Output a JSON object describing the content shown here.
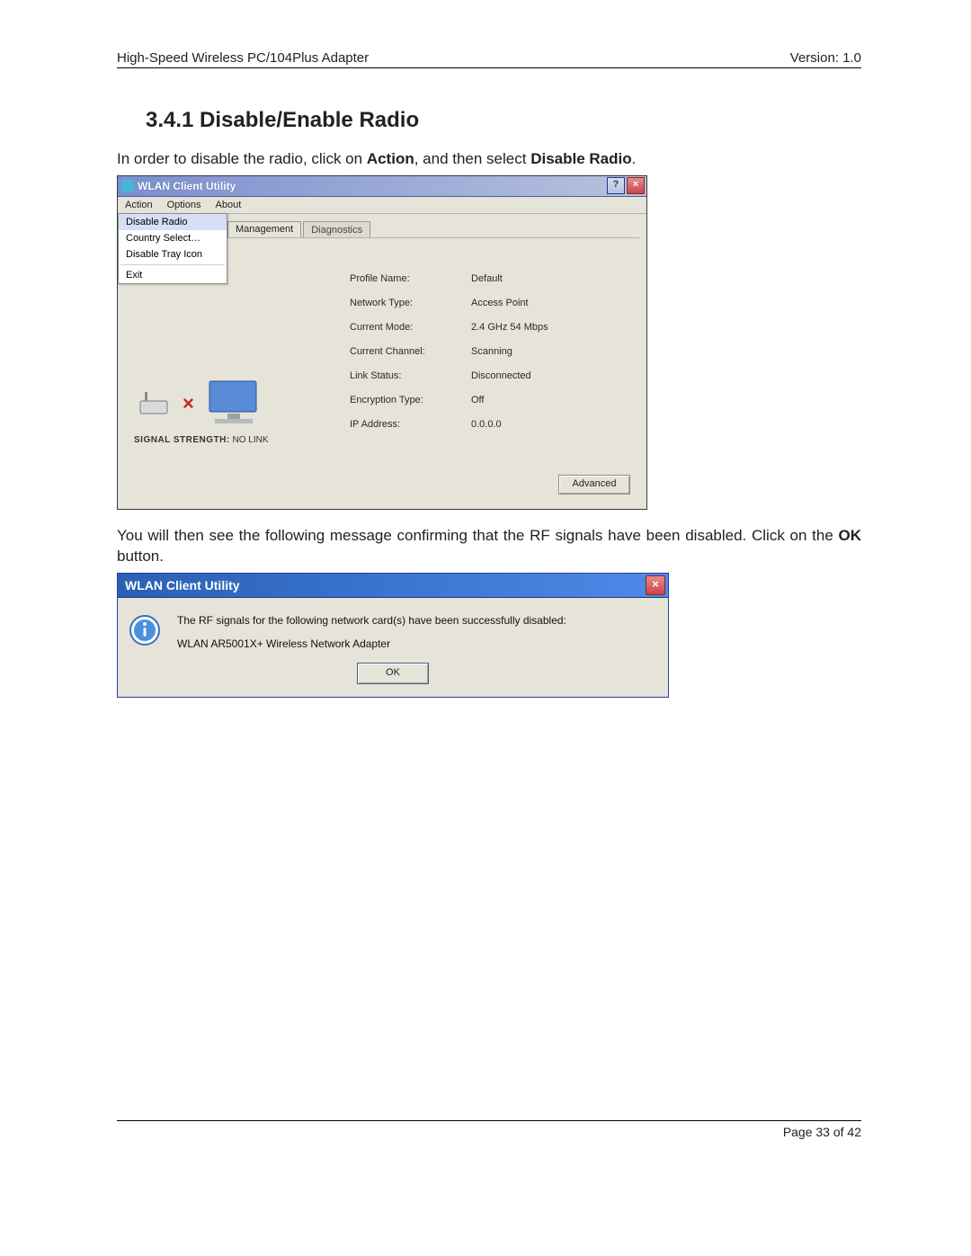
{
  "header": {
    "left": "High-Speed Wireless PC/104Plus Adapter",
    "right": "Version: 1.0"
  },
  "heading": "3.4.1  Disable/Enable Radio",
  "intro": {
    "pre": "In order to disable the radio, click on ",
    "b1": "Action",
    "mid": ", and then select ",
    "b2": "Disable Radio",
    "post": "."
  },
  "win1": {
    "title": "WLAN Client Utility",
    "help": "?",
    "close": "×",
    "menubar": [
      "Action",
      "Options",
      "About"
    ],
    "dropdown": {
      "items": [
        "Disable Radio",
        "Country Select…",
        "Disable Tray Icon"
      ],
      "exit": "Exit"
    },
    "tabs": [
      "Management",
      "Diagnostics"
    ],
    "status": [
      {
        "label": "Profile Name:",
        "value": "Default"
      },
      {
        "label": "Network Type:",
        "value": "Access Point"
      },
      {
        "label": "Current Mode:",
        "value": "2.4 GHz 54 Mbps"
      },
      {
        "label": "Current Channel:",
        "value": "Scanning"
      },
      {
        "label": "Link Status:",
        "value": "Disconnected"
      },
      {
        "label": "Encryption Type:",
        "value": "Off"
      },
      {
        "label": "IP Address:",
        "value": "0.0.0.0"
      }
    ],
    "signal_label": "SIGNAL STRENGTH:",
    "signal_value": "NO LINK",
    "advanced": "Advanced"
  },
  "para2": {
    "pre": "You will then see the following message confirming that the RF signals have been disabled. Click on the ",
    "b1": "OK",
    "post": " button."
  },
  "dlg2": {
    "title": "WLAN Client Utility",
    "close": "×",
    "msg1": "The RF signals for the following network card(s) have been successfully disabled:",
    "msg2": "WLAN AR5001X+ Wireless Network Adapter",
    "ok": "OK"
  },
  "footer": "Page 33 of 42"
}
